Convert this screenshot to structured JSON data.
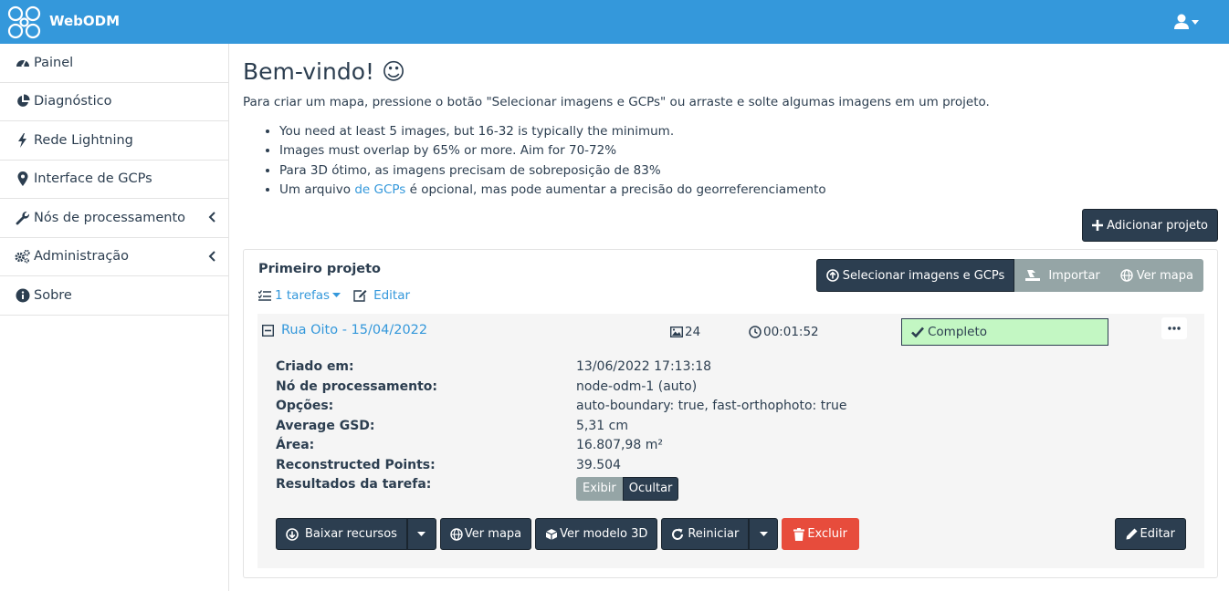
{
  "app": {
    "brand": "WebODM"
  },
  "sidebar": {
    "items": [
      {
        "label": "Painel",
        "icon": "dashboard-icon"
      },
      {
        "label": "Diagnóstico",
        "icon": "pie-chart-icon"
      },
      {
        "label": "Rede Lightning",
        "icon": "bolt-icon"
      },
      {
        "label": "Interface de GCPs",
        "icon": "map-marker-icon"
      },
      {
        "label": "Nós de processamento",
        "icon": "wrench-icon"
      },
      {
        "label": "Administração",
        "icon": "cogs-icon"
      },
      {
        "label": "Sobre",
        "icon": "info-icon"
      }
    ]
  },
  "main": {
    "title": "Bem-vindo! ☺",
    "intro": "Para criar um mapa, pressione o botão \"Selecionar imagens e GCPs\" ou arraste e solte algumas imagens em um projeto.",
    "tips": [
      "You need at least 5 images, but 16-32 is typically the minimum.",
      "Images must overlap by 65% or more. Aim for 70-72%",
      "Para 3D ótimo, as imagens precisam de sobreposição de 83%"
    ],
    "tip4_pre": "Um arquivo ",
    "tip4_link": "de GCPs",
    "tip4_post": " é opcional, mas pode aumentar a precisão do georreferenciamento",
    "add_project": "Adicionar projeto"
  },
  "project": {
    "name": "Primeiro projeto",
    "tasks_link": "1 tarefas",
    "edit_link": "Editar",
    "select_images": "Selecionar imagens e GCPs",
    "import": "Importar",
    "view_map": "Ver mapa"
  },
  "task": {
    "name": "Rua Oito - 15/04/2022",
    "image_count": "24",
    "duration": "00:01:52",
    "status": "Completo",
    "status_color": "#c3f7c3",
    "props": [
      {
        "key": "Criado em:",
        "value": "13/06/2022 17:13:18"
      },
      {
        "key": "Nó de processamento:",
        "value": "node-odm-1 (auto)"
      },
      {
        "key": "Opções:",
        "value": "auto-boundary: true, fast-orthophoto: true"
      },
      {
        "key": "Average GSD:",
        "value": "5,31 cm"
      },
      {
        "key": "Área:",
        "value": "16.807,98 m²"
      },
      {
        "key": "Reconstructed Points:",
        "value": "39.504"
      }
    ],
    "results_label": "Resultados da tarefa:",
    "show": "Exibir",
    "hide": "Ocultar",
    "download": "Baixar recursos",
    "view_map": "Ver mapa",
    "view_3d": "Ver modelo 3D",
    "restart": "Reiniciar",
    "delete": "Excluir",
    "edit": "Editar"
  },
  "colors": {
    "primary": "#3498db",
    "dark": "#2c3e50",
    "danger": "#e74c3c",
    "grey": "#95a5a6"
  }
}
